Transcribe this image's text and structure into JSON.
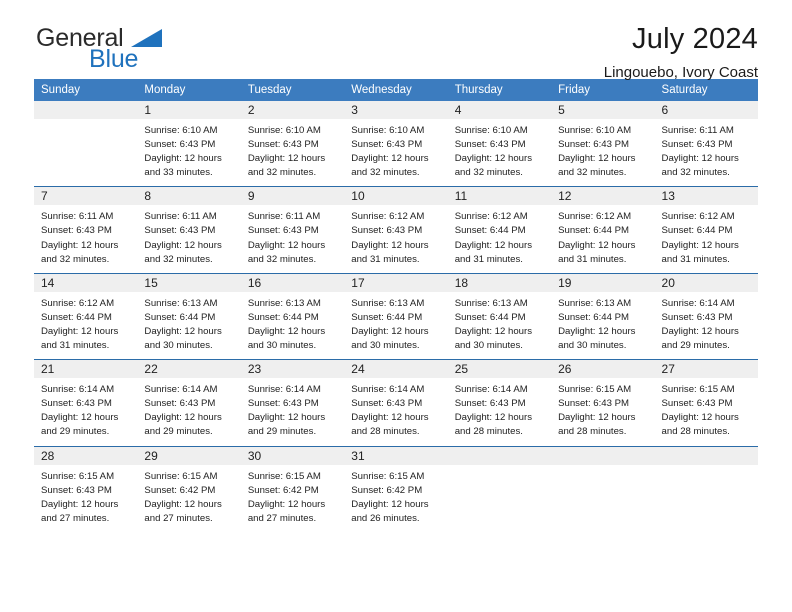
{
  "brand": {
    "name_part1": "General",
    "name_part2": "Blue",
    "accent_color": "#1f72bd",
    "triangle_icon": "brand-triangle-icon"
  },
  "header": {
    "title": "July 2024",
    "subtitle": "Lingouebo, Ivory Coast"
  },
  "calendar": {
    "header_bg": "#3c7cbf",
    "row_separator_color": "#2b6ca8",
    "daynum_bg": "#efefef",
    "weekdays": [
      "Sunday",
      "Monday",
      "Tuesday",
      "Wednesday",
      "Thursday",
      "Friday",
      "Saturday"
    ],
    "weeks": [
      [
        {
          "day": "",
          "sunrise": "",
          "sunset": "",
          "daylight_line1": "",
          "daylight_line2": ""
        },
        {
          "day": "1",
          "sunrise": "Sunrise: 6:10 AM",
          "sunset": "Sunset: 6:43 PM",
          "daylight_line1": "Daylight: 12 hours",
          "daylight_line2": "and 33 minutes."
        },
        {
          "day": "2",
          "sunrise": "Sunrise: 6:10 AM",
          "sunset": "Sunset: 6:43 PM",
          "daylight_line1": "Daylight: 12 hours",
          "daylight_line2": "and 32 minutes."
        },
        {
          "day": "3",
          "sunrise": "Sunrise: 6:10 AM",
          "sunset": "Sunset: 6:43 PM",
          "daylight_line1": "Daylight: 12 hours",
          "daylight_line2": "and 32 minutes."
        },
        {
          "day": "4",
          "sunrise": "Sunrise: 6:10 AM",
          "sunset": "Sunset: 6:43 PM",
          "daylight_line1": "Daylight: 12 hours",
          "daylight_line2": "and 32 minutes."
        },
        {
          "day": "5",
          "sunrise": "Sunrise: 6:10 AM",
          "sunset": "Sunset: 6:43 PM",
          "daylight_line1": "Daylight: 12 hours",
          "daylight_line2": "and 32 minutes."
        },
        {
          "day": "6",
          "sunrise": "Sunrise: 6:11 AM",
          "sunset": "Sunset: 6:43 PM",
          "daylight_line1": "Daylight: 12 hours",
          "daylight_line2": "and 32 minutes."
        }
      ],
      [
        {
          "day": "7",
          "sunrise": "Sunrise: 6:11 AM",
          "sunset": "Sunset: 6:43 PM",
          "daylight_line1": "Daylight: 12 hours",
          "daylight_line2": "and 32 minutes."
        },
        {
          "day": "8",
          "sunrise": "Sunrise: 6:11 AM",
          "sunset": "Sunset: 6:43 PM",
          "daylight_line1": "Daylight: 12 hours",
          "daylight_line2": "and 32 minutes."
        },
        {
          "day": "9",
          "sunrise": "Sunrise: 6:11 AM",
          "sunset": "Sunset: 6:43 PM",
          "daylight_line1": "Daylight: 12 hours",
          "daylight_line2": "and 32 minutes."
        },
        {
          "day": "10",
          "sunrise": "Sunrise: 6:12 AM",
          "sunset": "Sunset: 6:43 PM",
          "daylight_line1": "Daylight: 12 hours",
          "daylight_line2": "and 31 minutes."
        },
        {
          "day": "11",
          "sunrise": "Sunrise: 6:12 AM",
          "sunset": "Sunset: 6:44 PM",
          "daylight_line1": "Daylight: 12 hours",
          "daylight_line2": "and 31 minutes."
        },
        {
          "day": "12",
          "sunrise": "Sunrise: 6:12 AM",
          "sunset": "Sunset: 6:44 PM",
          "daylight_line1": "Daylight: 12 hours",
          "daylight_line2": "and 31 minutes."
        },
        {
          "day": "13",
          "sunrise": "Sunrise: 6:12 AM",
          "sunset": "Sunset: 6:44 PM",
          "daylight_line1": "Daylight: 12 hours",
          "daylight_line2": "and 31 minutes."
        }
      ],
      [
        {
          "day": "14",
          "sunrise": "Sunrise: 6:12 AM",
          "sunset": "Sunset: 6:44 PM",
          "daylight_line1": "Daylight: 12 hours",
          "daylight_line2": "and 31 minutes."
        },
        {
          "day": "15",
          "sunrise": "Sunrise: 6:13 AM",
          "sunset": "Sunset: 6:44 PM",
          "daylight_line1": "Daylight: 12 hours",
          "daylight_line2": "and 30 minutes."
        },
        {
          "day": "16",
          "sunrise": "Sunrise: 6:13 AM",
          "sunset": "Sunset: 6:44 PM",
          "daylight_line1": "Daylight: 12 hours",
          "daylight_line2": "and 30 minutes."
        },
        {
          "day": "17",
          "sunrise": "Sunrise: 6:13 AM",
          "sunset": "Sunset: 6:44 PM",
          "daylight_line1": "Daylight: 12 hours",
          "daylight_line2": "and 30 minutes."
        },
        {
          "day": "18",
          "sunrise": "Sunrise: 6:13 AM",
          "sunset": "Sunset: 6:44 PM",
          "daylight_line1": "Daylight: 12 hours",
          "daylight_line2": "and 30 minutes."
        },
        {
          "day": "19",
          "sunrise": "Sunrise: 6:13 AM",
          "sunset": "Sunset: 6:44 PM",
          "daylight_line1": "Daylight: 12 hours",
          "daylight_line2": "and 30 minutes."
        },
        {
          "day": "20",
          "sunrise": "Sunrise: 6:14 AM",
          "sunset": "Sunset: 6:43 PM",
          "daylight_line1": "Daylight: 12 hours",
          "daylight_line2": "and 29 minutes."
        }
      ],
      [
        {
          "day": "21",
          "sunrise": "Sunrise: 6:14 AM",
          "sunset": "Sunset: 6:43 PM",
          "daylight_line1": "Daylight: 12 hours",
          "daylight_line2": "and 29 minutes."
        },
        {
          "day": "22",
          "sunrise": "Sunrise: 6:14 AM",
          "sunset": "Sunset: 6:43 PM",
          "daylight_line1": "Daylight: 12 hours",
          "daylight_line2": "and 29 minutes."
        },
        {
          "day": "23",
          "sunrise": "Sunrise: 6:14 AM",
          "sunset": "Sunset: 6:43 PM",
          "daylight_line1": "Daylight: 12 hours",
          "daylight_line2": "and 29 minutes."
        },
        {
          "day": "24",
          "sunrise": "Sunrise: 6:14 AM",
          "sunset": "Sunset: 6:43 PM",
          "daylight_line1": "Daylight: 12 hours",
          "daylight_line2": "and 28 minutes."
        },
        {
          "day": "25",
          "sunrise": "Sunrise: 6:14 AM",
          "sunset": "Sunset: 6:43 PM",
          "daylight_line1": "Daylight: 12 hours",
          "daylight_line2": "and 28 minutes."
        },
        {
          "day": "26",
          "sunrise": "Sunrise: 6:15 AM",
          "sunset": "Sunset: 6:43 PM",
          "daylight_line1": "Daylight: 12 hours",
          "daylight_line2": "and 28 minutes."
        },
        {
          "day": "27",
          "sunrise": "Sunrise: 6:15 AM",
          "sunset": "Sunset: 6:43 PM",
          "daylight_line1": "Daylight: 12 hours",
          "daylight_line2": "and 28 minutes."
        }
      ],
      [
        {
          "day": "28",
          "sunrise": "Sunrise: 6:15 AM",
          "sunset": "Sunset: 6:43 PM",
          "daylight_line1": "Daylight: 12 hours",
          "daylight_line2": "and 27 minutes."
        },
        {
          "day": "29",
          "sunrise": "Sunrise: 6:15 AM",
          "sunset": "Sunset: 6:42 PM",
          "daylight_line1": "Daylight: 12 hours",
          "daylight_line2": "and 27 minutes."
        },
        {
          "day": "30",
          "sunrise": "Sunrise: 6:15 AM",
          "sunset": "Sunset: 6:42 PM",
          "daylight_line1": "Daylight: 12 hours",
          "daylight_line2": "and 27 minutes."
        },
        {
          "day": "31",
          "sunrise": "Sunrise: 6:15 AM",
          "sunset": "Sunset: 6:42 PM",
          "daylight_line1": "Daylight: 12 hours",
          "daylight_line2": "and 26 minutes."
        },
        {
          "day": "",
          "sunrise": "",
          "sunset": "",
          "daylight_line1": "",
          "daylight_line2": ""
        },
        {
          "day": "",
          "sunrise": "",
          "sunset": "",
          "daylight_line1": "",
          "daylight_line2": ""
        },
        {
          "day": "",
          "sunrise": "",
          "sunset": "",
          "daylight_line1": "",
          "daylight_line2": ""
        }
      ]
    ]
  }
}
